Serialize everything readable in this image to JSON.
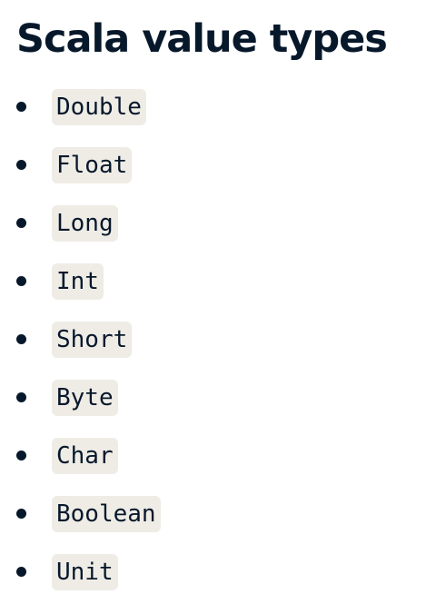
{
  "title": "Scala value types",
  "types": [
    "Double",
    "Float",
    "Long",
    "Int",
    "Short",
    "Byte",
    "Char",
    "Boolean",
    "Unit"
  ]
}
